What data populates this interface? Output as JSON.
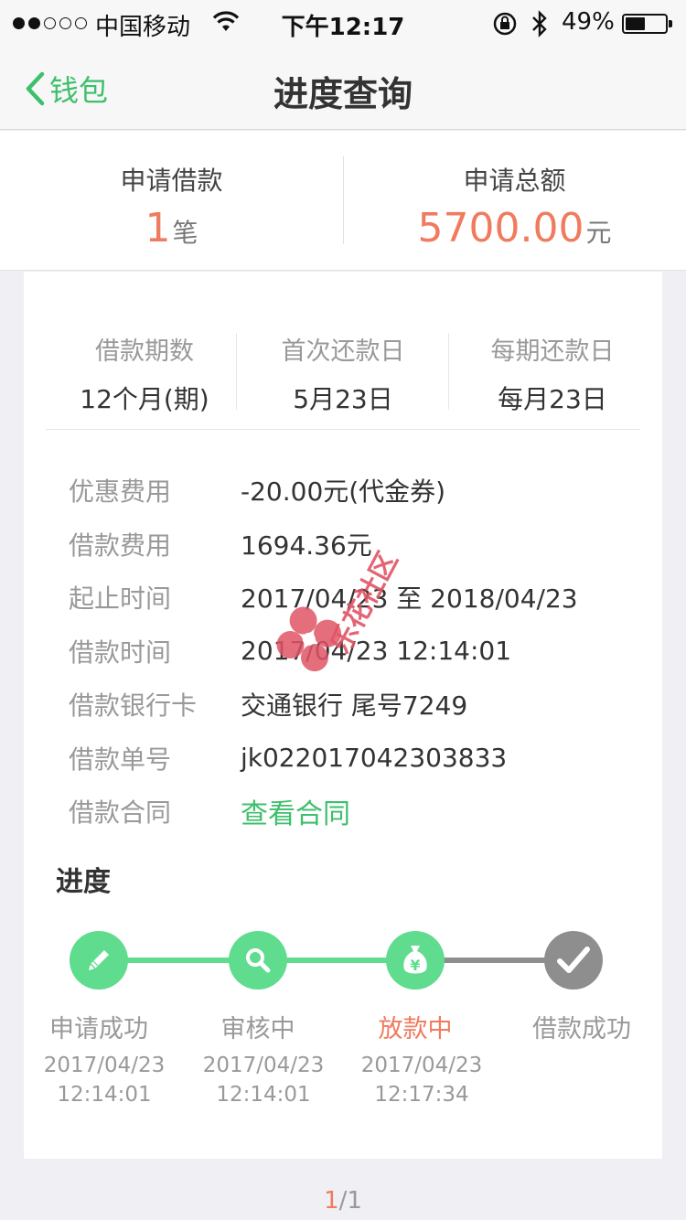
{
  "status_bar": {
    "carrier": "中国移动",
    "time": "下午12:17",
    "battery": "49%",
    "battery_level": 0.49
  },
  "nav": {
    "back_label": "钱包",
    "title": "进度查询"
  },
  "summary": {
    "count_label": "申请借款",
    "count_value": "1",
    "count_unit": "笔",
    "total_label": "申请总额",
    "total_value": "5700.00",
    "total_unit": "元"
  },
  "terms": [
    {
      "label": "借款期数",
      "value": "12个月(期)"
    },
    {
      "label": "首次还款日",
      "value": "5月23日"
    },
    {
      "label": "每期还款日",
      "value": "每月23日"
    }
  ],
  "details": [
    {
      "label": "优惠费用",
      "value": "-20.00元(代金券)"
    },
    {
      "label": "借款费用",
      "value": "1694.36元"
    },
    {
      "label": "起止时间",
      "value": "2017/04/23 至 2018/04/23"
    },
    {
      "label": "借款时间",
      "value": "2017/04/23 12:14:01"
    },
    {
      "label": "借款银行卡",
      "value": "交通银行 尾号7249"
    },
    {
      "label": "借款单号",
      "value": "jk022017042303833"
    },
    {
      "label": "借款合同",
      "value": "查看合同"
    }
  ],
  "progress": {
    "title": "进度",
    "steps": [
      {
        "label": "申请成功",
        "date": "2017/04/23",
        "time": "12:14:01",
        "icon": "pencil-icon",
        "status": "done"
      },
      {
        "label": "审核中",
        "date": "2017/04/23",
        "time": "12:14:01",
        "icon": "search-icon",
        "status": "done"
      },
      {
        "label": "放款中",
        "date": "2017/04/23",
        "time": "12:17:34",
        "icon": "money-bag-icon",
        "status": "active"
      },
      {
        "label": "借款成功",
        "icon": "check-icon",
        "status": "pending"
      }
    ]
  },
  "watermark": {
    "text": "乐花社区"
  },
  "pager": {
    "current": "1",
    "total": "/1"
  },
  "colors": {
    "green": "#3dbf6b",
    "step_green": "#5fdc8e",
    "orange": "#f07b5e",
    "gray": "#8e8e8e"
  }
}
